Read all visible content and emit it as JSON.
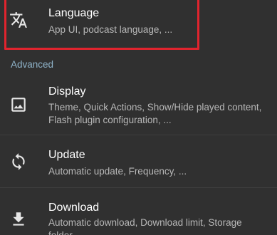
{
  "settings": {
    "language": {
      "title": "Language",
      "summary": "App UI, podcast language, ...",
      "icon": "translate-icon"
    },
    "section_header": "Advanced",
    "display": {
      "title": "Display",
      "summary": "Theme, Quick Actions, Show/Hide played content, Flash plugin configuration, ...",
      "icon": "image-icon"
    },
    "update": {
      "title": "Update",
      "summary": "Automatic update, Frequency, ...",
      "icon": "refresh-icon"
    },
    "download": {
      "title": "Download",
      "summary": "Automatic download, Download limit, Storage folder, ...",
      "icon": "download-icon"
    }
  },
  "colors": {
    "background": "#303030",
    "highlight_border": "#e0242e",
    "section_header": "#8fb3c9",
    "title": "#ffffff",
    "summary": "#b8b8b8"
  }
}
